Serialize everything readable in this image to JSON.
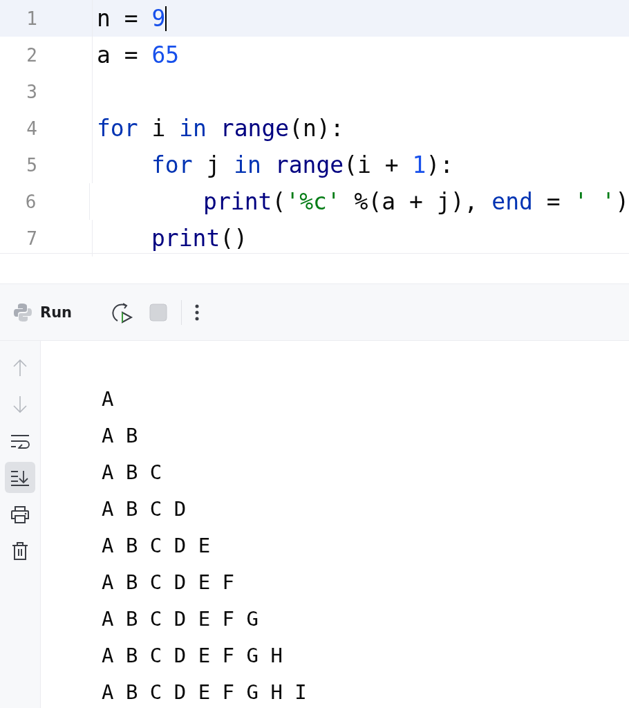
{
  "editor": {
    "lines": [
      {
        "number": "1",
        "selected": true,
        "tokens": [
          {
            "kind": "plain",
            "text": "n = "
          },
          {
            "kind": "number",
            "text": "9"
          }
        ]
      },
      {
        "number": "2",
        "selected": false,
        "tokens": [
          {
            "kind": "plain",
            "text": "a = "
          },
          {
            "kind": "number",
            "text": "65"
          }
        ]
      },
      {
        "number": "3",
        "selected": false
      },
      {
        "number": "4",
        "selected": false,
        "tokens": [
          {
            "kind": "keyword",
            "text": "for"
          },
          {
            "kind": "plain",
            "text": " i "
          },
          {
            "kind": "keyword",
            "text": "in "
          },
          {
            "kind": "builtin",
            "text": "range"
          },
          {
            "kind": "plain",
            "text": "(n):"
          }
        ],
        "children": [
          {
            "number": "5",
            "selected": false,
            "tokens": [
              {
                "kind": "keyword",
                "text": "for"
              },
              {
                "kind": "plain",
                "text": " j "
              },
              {
                "kind": "keyword",
                "text": "in "
              },
              {
                "kind": "builtin",
                "text": "range"
              },
              {
                "kind": "plain",
                "text": "(i + "
              },
              {
                "kind": "number",
                "text": "1"
              },
              {
                "kind": "plain",
                "text": "):"
              }
            ],
            "children": [
              {
                "number": "6",
                "selected": false,
                "tokens": [
                  {
                    "kind": "builtin",
                    "text": "print"
                  },
                  {
                    "kind": "plain",
                    "text": "("
                  },
                  {
                    "kind": "string",
                    "text": "'%c'"
                  },
                  {
                    "kind": "plain",
                    "text": " %(a + j), "
                  },
                  {
                    "kind": "keyword",
                    "text": "end"
                  },
                  {
                    "kind": "plain",
                    "text": " = "
                  },
                  {
                    "kind": "string",
                    "text": "' '"
                  },
                  {
                    "kind": "plain",
                    "text": ")"
                  }
                ]
              }
            ]
          },
          {
            "number": "7",
            "selected": false,
            "tokens": [
              {
                "kind": "builtin",
                "text": "print"
              },
              {
                "kind": "plain",
                "text": "()"
              }
            ]
          }
        ]
      }
    ]
  },
  "run_panel": {
    "title": "Run",
    "toolbar": [
      {
        "kind": "rerun",
        "disabled": false
      },
      {
        "kind": "stop",
        "disabled": true
      },
      {
        "kind": "more",
        "disabled": false
      }
    ],
    "side_tools": [
      {
        "kind": "up",
        "disabled": true,
        "selected": false
      },
      {
        "kind": "down",
        "disabled": true,
        "selected": false
      },
      {
        "kind": "wrap",
        "disabled": false,
        "selected": false
      },
      {
        "kind": "scroll-end",
        "disabled": false,
        "selected": true
      },
      {
        "kind": "print",
        "disabled": false,
        "selected": false
      },
      {
        "kind": "trash",
        "disabled": false,
        "selected": false
      }
    ],
    "output": [
      "A",
      "A B",
      "A B C",
      "A B C D",
      "A B C D E",
      "A B C D E F",
      "A B C D E F G",
      "A B C D E F G H",
      "A B C D E F G H I"
    ]
  }
}
